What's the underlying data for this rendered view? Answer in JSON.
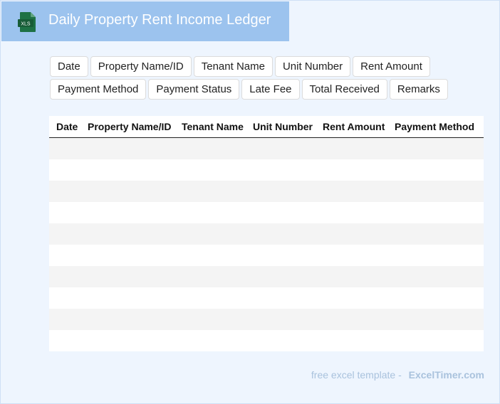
{
  "header": {
    "title": "Daily Property Rent Income Ledger",
    "icon": "xls-file-icon",
    "icon_label": "XLS"
  },
  "tags": {
    "row1": [
      "Date",
      "Property Name/ID",
      "Tenant Name",
      "Unit Number",
      "Rent Amount"
    ],
    "row2": [
      "Payment Method",
      "Payment Status",
      "Late Fee",
      "Total Received",
      "Remarks"
    ]
  },
  "table": {
    "columns": [
      "Date",
      "Property Name/ID",
      "Tenant Name",
      "Unit Number",
      "Rent Amount",
      "Payment Method"
    ],
    "empty_rows": 10
  },
  "footer": {
    "prefix": "free excel template -",
    "brand": "ExcelTimer.com"
  },
  "colors": {
    "header_bg": "#9cc3ee",
    "page_bg": "#eef5fe",
    "icon_green": "#1e7145",
    "stripe": "#f4f4f4",
    "footer_text": "#a9c2dd"
  }
}
